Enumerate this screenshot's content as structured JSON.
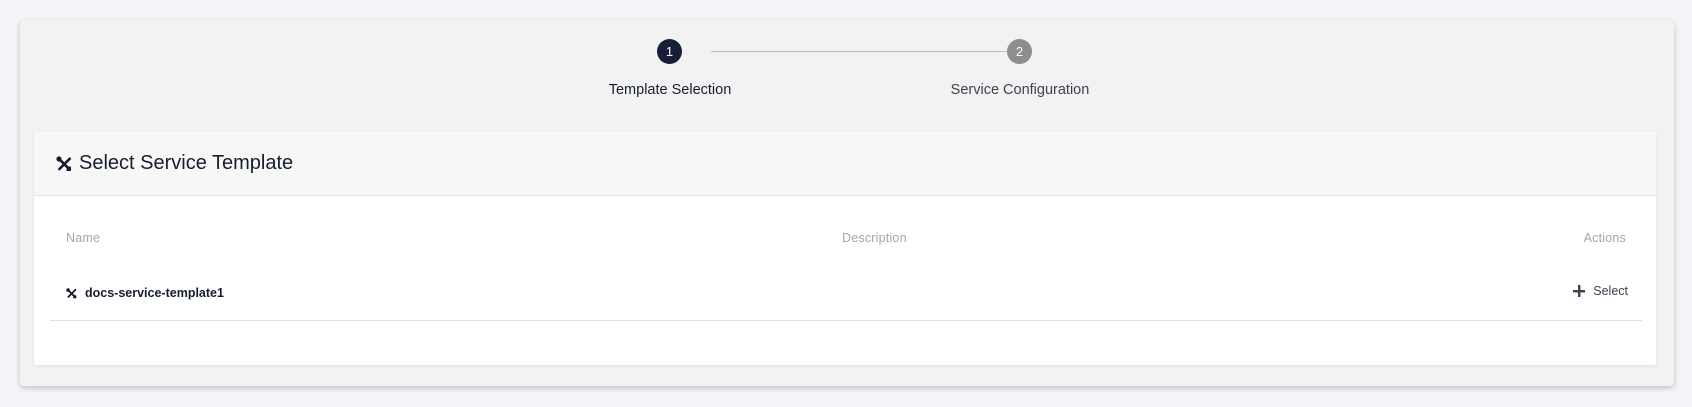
{
  "wizard": {
    "steps": [
      {
        "number": "1",
        "label": "Template Selection",
        "state": "active"
      },
      {
        "number": "2",
        "label": "Service Configuration",
        "state": "inactive"
      }
    ]
  },
  "card": {
    "title": "Select Service Template",
    "title_icon": "tools-icon"
  },
  "table": {
    "columns": {
      "name": "Name",
      "description": "Description",
      "actions": "Actions"
    },
    "rows": [
      {
        "name": "docs-service-template1",
        "description": "",
        "action_label": "Select"
      }
    ]
  },
  "colors": {
    "active_step": "#161e38",
    "inactive_step": "#8e8e8e"
  }
}
